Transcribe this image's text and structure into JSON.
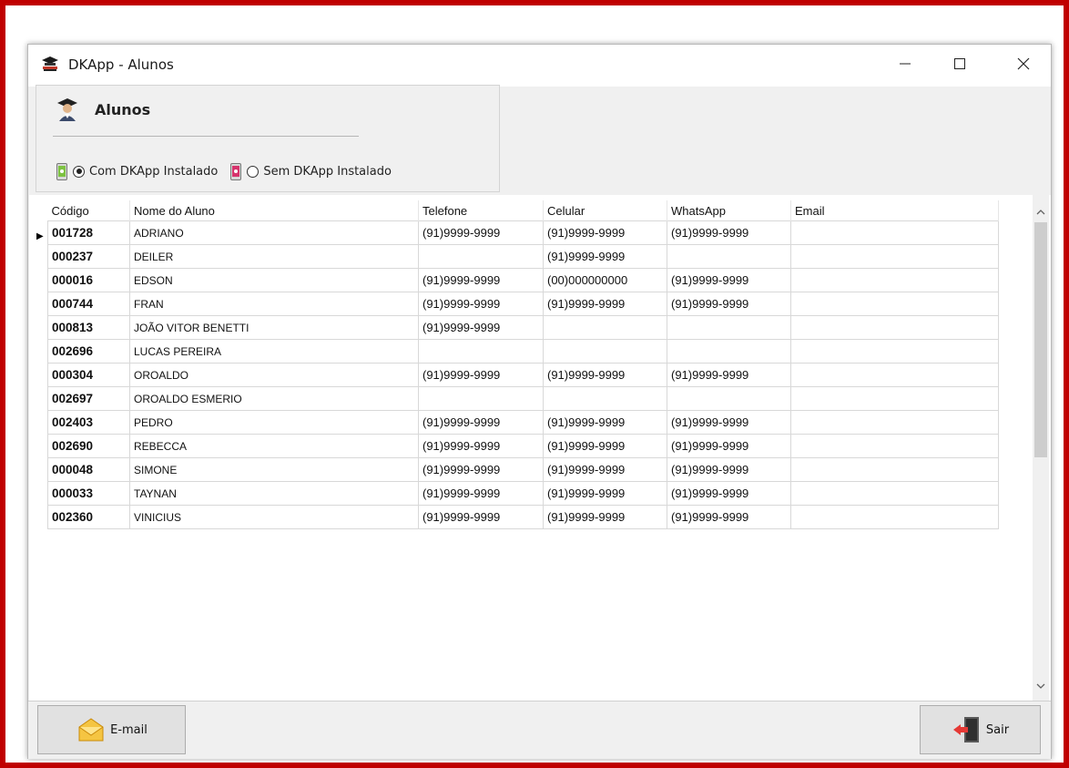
{
  "window": {
    "title": "DKApp - Alunos"
  },
  "panel": {
    "title": "Alunos",
    "radio_installed": "Com DKApp Instalado",
    "radio_not_installed": "Sem DKApp Instalado"
  },
  "table": {
    "headers": [
      "Código",
      "Nome do Aluno",
      "Telefone",
      "Celular",
      "WhatsApp",
      "Email"
    ],
    "rows": [
      {
        "codigo": "001728",
        "nome": "ADRIANO",
        "telefone": "(91)9999-9999",
        "celular": "(91)9999-9999",
        "whatsapp": "(91)9999-9999",
        "email": ""
      },
      {
        "codigo": "000237",
        "nome": "DEILER",
        "telefone": "",
        "celular": "(91)9999-9999",
        "whatsapp": "",
        "email": ""
      },
      {
        "codigo": "000016",
        "nome": "EDSON",
        "telefone": "(91)9999-9999",
        "celular": "(00)000000000",
        "whatsapp": "(91)9999-9999",
        "email": ""
      },
      {
        "codigo": "000744",
        "nome": "FRAN",
        "telefone": "(91)9999-9999",
        "celular": "(91)9999-9999",
        "whatsapp": "(91)9999-9999",
        "email": ""
      },
      {
        "codigo": "000813",
        "nome": "JOÃO VITOR BENETTI",
        "telefone": "(91)9999-9999",
        "celular": "",
        "whatsapp": "",
        "email": ""
      },
      {
        "codigo": "002696",
        "nome": "LUCAS PEREIRA",
        "telefone": "",
        "celular": "",
        "whatsapp": "",
        "email": ""
      },
      {
        "codigo": "000304",
        "nome": "OROALDO",
        "telefone": "(91)9999-9999",
        "celular": "(91)9999-9999",
        "whatsapp": "(91)9999-9999",
        "email": ""
      },
      {
        "codigo": "002697",
        "nome": "OROALDO ESMERIO",
        "telefone": "",
        "celular": "",
        "whatsapp": "",
        "email": ""
      },
      {
        "codigo": "002403",
        "nome": "PEDRO",
        "telefone": "(91)9999-9999",
        "celular": "(91)9999-9999",
        "whatsapp": "(91)9999-9999",
        "email": ""
      },
      {
        "codigo": "002690",
        "nome": "REBECCA",
        "telefone": "(91)9999-9999",
        "celular": "(91)9999-9999",
        "whatsapp": "(91)9999-9999",
        "email": ""
      },
      {
        "codigo": "000048",
        "nome": "SIMONE",
        "telefone": "(91)9999-9999",
        "celular": "(91)9999-9999",
        "whatsapp": "(91)9999-9999",
        "email": ""
      },
      {
        "codigo": "000033",
        "nome": "TAYNAN",
        "telefone": "(91)9999-9999",
        "celular": "(91)9999-9999",
        "whatsapp": "(91)9999-9999",
        "email": ""
      },
      {
        "codigo": "002360",
        "nome": "VINICIUS",
        "telefone": "(91)9999-9999",
        "celular": "(91)9999-9999",
        "whatsapp": "(91)9999-9999",
        "email": ""
      }
    ]
  },
  "buttons": {
    "email": "E-mail",
    "sair": "Sair"
  },
  "colors": {
    "frame": "#c00000",
    "window_bg": "#f0f0f0",
    "grid_bg": "#ffffff"
  },
  "icons": {
    "app": "dkapp-logo-icon",
    "student": "student-graduate-icon",
    "installed": "phone-green-icon",
    "not_installed": "phone-red-icon",
    "email": "envelope-icon",
    "exit": "exit-door-icon"
  }
}
